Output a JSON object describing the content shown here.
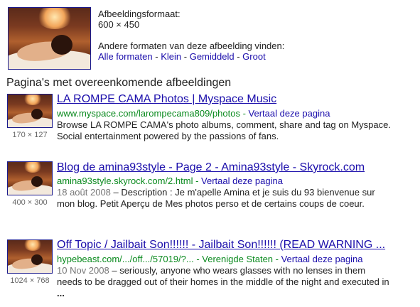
{
  "query_image": {
    "format_label": "Afbeeldingsformaat:",
    "size": "600 × 450",
    "other_formats_label": "Andere formaten van deze afbeelding vinden:",
    "links": [
      "Alle formaten",
      "Klein",
      "Gemiddeld",
      "Groot"
    ],
    "separator": "-"
  },
  "section": {
    "heading": "Pagina's met overeenkomende afbeeldingen"
  },
  "results": [
    {
      "title": "LA ROMPE CAMA Photos | Myspace Music",
      "url": "www.myspace.com/larompecama809/photos",
      "url_sep": " - ",
      "translate": "Vertaal deze pagina",
      "date": "",
      "snippet": "Browse LA ROMPE CAMA's photo albums, comment, share and tag on Myspace. Social entertainment powered by the passions of fans.",
      "thumb_size": "170 × 127"
    },
    {
      "title": "Blog de amina93style - Page 2 - Amina93style - Skyrock.com",
      "url": "amina93style.skyrock.com/2.html",
      "url_sep": " - ",
      "translate": "Vertaal deze pagina",
      "date": "18 août 2008",
      "date_sep": " – ",
      "snippet": "Description : Je m'apelle Amina et je suis du 93 bienvenue sur mon blog. Petit Aperçu de Mes photos perso et de certains coups de coeur.",
      "thumb_size": "400 × 300"
    },
    {
      "title": "Off Topic / Jailbait Son!!!!!! - Jailbait Son!!!!!! (READ WARNING ...",
      "url": "hypebeast.com/.../off.../57019/?...",
      "url_sep": " - ",
      "region": "Verenigde Staten",
      "translate": "Vertaal deze pagina",
      "date": "10 Nov 2008",
      "date_sep": " – ",
      "snippet": "seriously, anyone who wears glasses with no lenses in them needs to be dragged out of their homes in the middle of the night and executed in ",
      "snippet_end": "...",
      "thumb_size": "1024 × 768"
    }
  ],
  "colors": {
    "link": "#1a0dab",
    "url": "#0a8a1e",
    "meta": "#777777"
  }
}
